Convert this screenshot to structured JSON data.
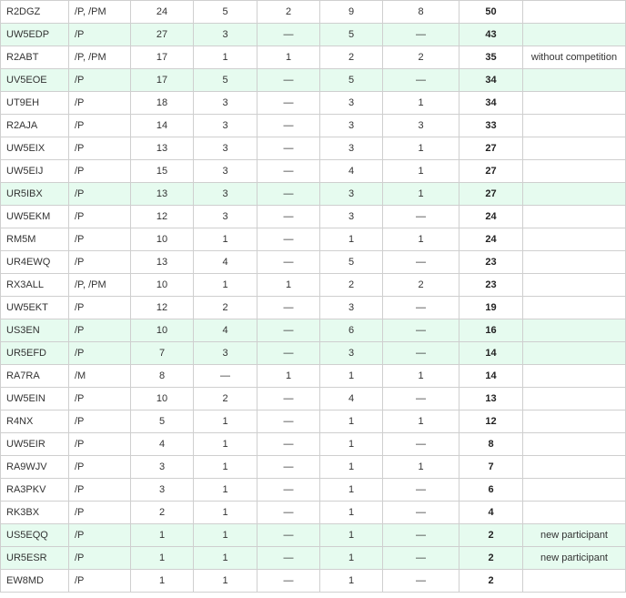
{
  "table": {
    "rows": [
      {
        "call": "R2DGZ",
        "suffix": "/P, /PM",
        "c1": "24",
        "c2": "5",
        "c3": "2",
        "c4": "9",
        "c5": "8",
        "total": "50",
        "note": "",
        "highlighted": false
      },
      {
        "call": "UW5EDP",
        "suffix": "/P",
        "c1": "27",
        "c2": "3",
        "c3": "—",
        "c4": "5",
        "c5": "—",
        "total": "43",
        "note": "",
        "highlighted": true
      },
      {
        "call": "R2ABT",
        "suffix": "/P, /PM",
        "c1": "17",
        "c2": "1",
        "c3": "1",
        "c4": "2",
        "c5": "2",
        "total": "35",
        "note": "without competition",
        "highlighted": false
      },
      {
        "call": "UV5EOE",
        "suffix": "/P",
        "c1": "17",
        "c2": "5",
        "c3": "—",
        "c4": "5",
        "c5": "—",
        "total": "34",
        "note": "",
        "highlighted": true
      },
      {
        "call": "UT9EH",
        "suffix": "/P",
        "c1": "18",
        "c2": "3",
        "c3": "—",
        "c4": "3",
        "c5": "1",
        "total": "34",
        "note": "",
        "highlighted": false
      },
      {
        "call": "R2AJA",
        "suffix": "/P",
        "c1": "14",
        "c2": "3",
        "c3": "—",
        "c4": "3",
        "c5": "3",
        "total": "33",
        "note": "",
        "highlighted": false
      },
      {
        "call": "UW5EIX",
        "suffix": "/P",
        "c1": "13",
        "c2": "3",
        "c3": "—",
        "c4": "3",
        "c5": "1",
        "total": "27",
        "note": "",
        "highlighted": false
      },
      {
        "call": "UW5EIJ",
        "suffix": "/P",
        "c1": "15",
        "c2": "3",
        "c3": "—",
        "c4": "4",
        "c5": "1",
        "total": "27",
        "note": "",
        "highlighted": false
      },
      {
        "call": "UR5IBX",
        "suffix": "/P",
        "c1": "13",
        "c2": "3",
        "c3": "—",
        "c4": "3",
        "c5": "1",
        "total": "27",
        "note": "",
        "highlighted": true
      },
      {
        "call": "UW5EKM",
        "suffix": "/P",
        "c1": "12",
        "c2": "3",
        "c3": "—",
        "c4": "3",
        "c5": "—",
        "total": "24",
        "note": "",
        "highlighted": false
      },
      {
        "call": "RM5M",
        "suffix": "/P",
        "c1": "10",
        "c2": "1",
        "c3": "—",
        "c4": "1",
        "c5": "1",
        "total": "24",
        "note": "",
        "highlighted": false
      },
      {
        "call": "UR4EWQ",
        "suffix": "/P",
        "c1": "13",
        "c2": "4",
        "c3": "—",
        "c4": "5",
        "c5": "—",
        "total": "23",
        "note": "",
        "highlighted": false
      },
      {
        "call": "RX3ALL",
        "suffix": "/P, /PM",
        "c1": "10",
        "c2": "1",
        "c3": "1",
        "c4": "2",
        "c5": "2",
        "total": "23",
        "note": "",
        "highlighted": false
      },
      {
        "call": "UW5EKT",
        "suffix": "/P",
        "c1": "12",
        "c2": "2",
        "c3": "—",
        "c4": "3",
        "c5": "—",
        "total": "19",
        "note": "",
        "highlighted": false
      },
      {
        "call": "US3EN",
        "suffix": "/P",
        "c1": "10",
        "c2": "4",
        "c3": "—",
        "c4": "6",
        "c5": "—",
        "total": "16",
        "note": "",
        "highlighted": true
      },
      {
        "call": "UR5EFD",
        "suffix": "/P",
        "c1": "7",
        "c2": "3",
        "c3": "—",
        "c4": "3",
        "c5": "—",
        "total": "14",
        "note": "",
        "highlighted": true
      },
      {
        "call": "RA7RA",
        "suffix": "/M",
        "c1": "8",
        "c2": "—",
        "c3": "1",
        "c4": "1",
        "c5": "1",
        "total": "14",
        "note": "",
        "highlighted": false
      },
      {
        "call": "UW5EIN",
        "suffix": "/P",
        "c1": "10",
        "c2": "2",
        "c3": "—",
        "c4": "4",
        "c5": "—",
        "total": "13",
        "note": "",
        "highlighted": false
      },
      {
        "call": "R4NX",
        "suffix": "/P",
        "c1": "5",
        "c2": "1",
        "c3": "—",
        "c4": "1",
        "c5": "1",
        "total": "12",
        "note": "",
        "highlighted": false
      },
      {
        "call": "UW5EIR",
        "suffix": "/P",
        "c1": "4",
        "c2": "1",
        "c3": "—",
        "c4": "1",
        "c5": "—",
        "total": "8",
        "note": "",
        "highlighted": false
      },
      {
        "call": "RA9WJV",
        "suffix": "/P",
        "c1": "3",
        "c2": "1",
        "c3": "—",
        "c4": "1",
        "c5": "1",
        "total": "7",
        "note": "",
        "highlighted": false
      },
      {
        "call": "RA3PKV",
        "suffix": "/P",
        "c1": "3",
        "c2": "1",
        "c3": "—",
        "c4": "1",
        "c5": "—",
        "total": "6",
        "note": "",
        "highlighted": false
      },
      {
        "call": "RK3BX",
        "suffix": "/P",
        "c1": "2",
        "c2": "1",
        "c3": "—",
        "c4": "1",
        "c5": "—",
        "total": "4",
        "note": "",
        "highlighted": false
      },
      {
        "call": "US5EQQ",
        "suffix": "/P",
        "c1": "1",
        "c2": "1",
        "c3": "—",
        "c4": "1",
        "c5": "—",
        "total": "2",
        "note": "new participant",
        "highlighted": true
      },
      {
        "call": "UR5ESR",
        "suffix": "/P",
        "c1": "1",
        "c2": "1",
        "c3": "—",
        "c4": "1",
        "c5": "—",
        "total": "2",
        "note": "new participant",
        "highlighted": true
      },
      {
        "call": "EW8MD",
        "suffix": "/P",
        "c1": "1",
        "c2": "1",
        "c3": "—",
        "c4": "1",
        "c5": "—",
        "total": "2",
        "note": "",
        "highlighted": false
      }
    ]
  },
  "colors": {
    "highlight_row": "#e6fbef",
    "border": "#cfcfcf",
    "text": "#333333"
  }
}
